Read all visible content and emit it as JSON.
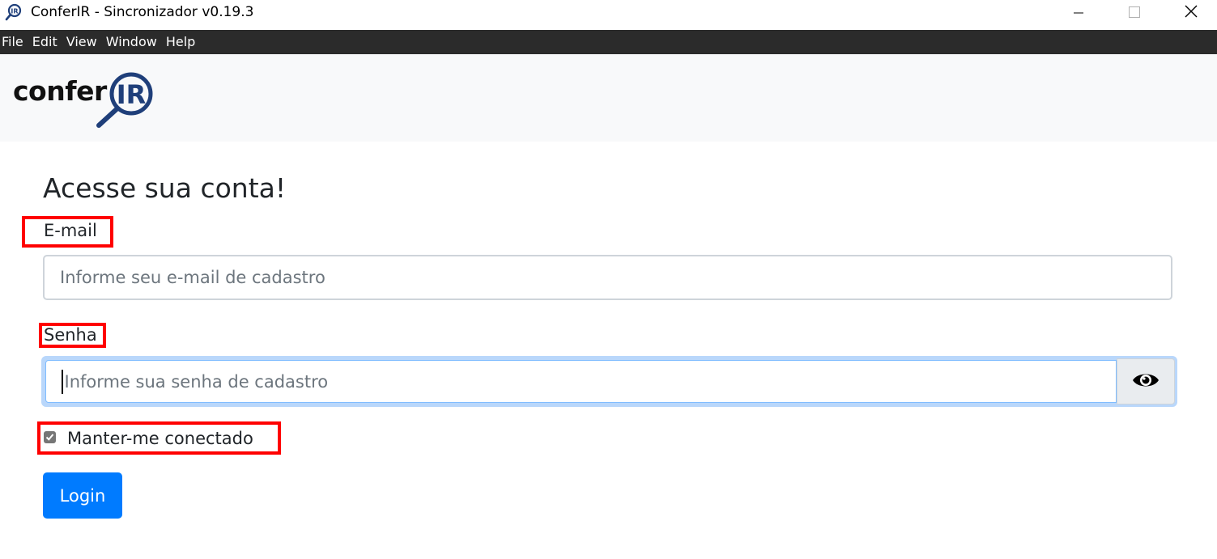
{
  "window": {
    "title": "ConferIR - Sincronizador v0.19.3",
    "app_icon": "magnifier-ir-icon",
    "controls": [
      "minimize-icon",
      "maximize-icon",
      "close-icon"
    ]
  },
  "menubar": {
    "items": [
      "File",
      "Edit",
      "View",
      "Window",
      "Help"
    ]
  },
  "header": {
    "logo_text": "conferIR"
  },
  "login": {
    "title": "Acesse sua conta!",
    "email_label": "E-mail",
    "email_placeholder": "Informe seu e-mail de cadastro",
    "email_value": "",
    "password_label": "Senha",
    "password_placeholder": "Informe sua senha de cadastro",
    "password_value": "",
    "toggle_password_icon": "eye-icon",
    "remember_label": "Manter-me conectado",
    "remember_checked": true,
    "login_button": "Login"
  },
  "colors": {
    "primary": "#007bff",
    "highlight": "#ff0000",
    "menubar": "#2b2b2b",
    "header_bg": "#f8f9fa",
    "logo_blue": "#1f3f7a"
  }
}
